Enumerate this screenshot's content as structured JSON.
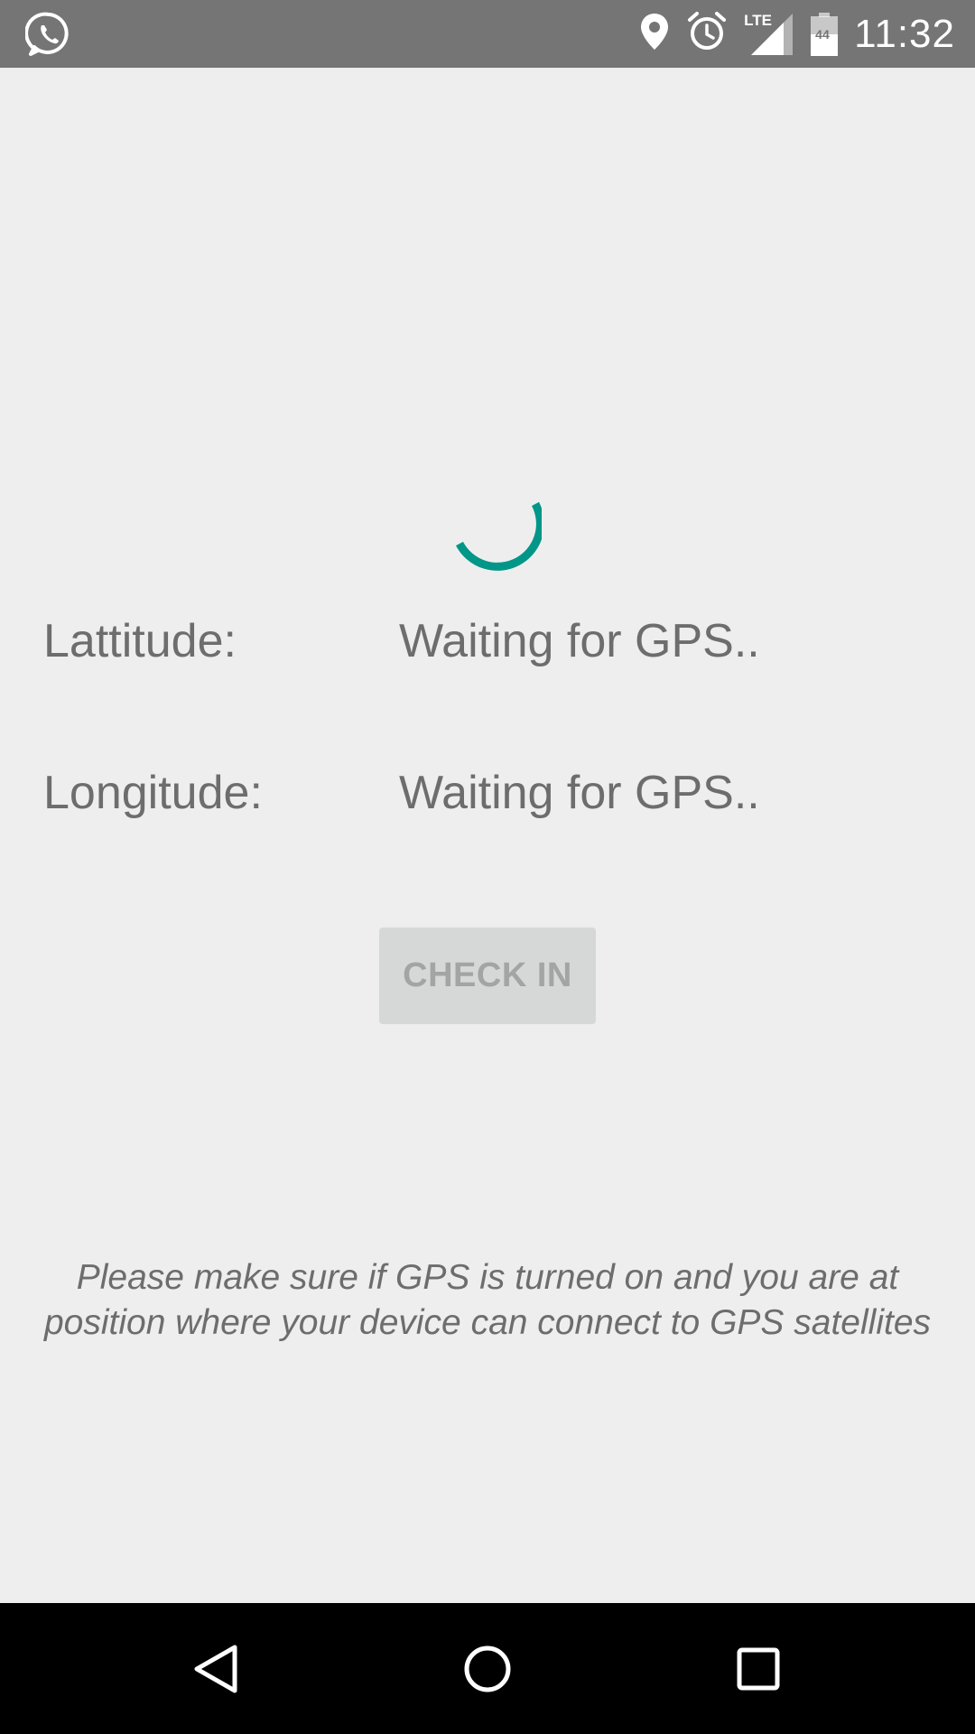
{
  "status_bar": {
    "time": "11:32",
    "network_label": "LTE",
    "battery_level": "44",
    "icons": [
      "whatsapp-icon",
      "location-pin-icon",
      "alarm-icon",
      "lte-signal-icon",
      "battery-icon"
    ]
  },
  "main": {
    "latitude_label": "Lattitude:",
    "latitude_value": "Waiting for GPS..",
    "longitude_label": "Longitude:",
    "longitude_value": "Waiting for GPS..",
    "checkin_label": "CHECK IN",
    "notice_line1": "Please make sure if GPS is turned on and you are at",
    "notice_line2": "position where your device can connect to GPS satellites"
  },
  "colors": {
    "status_bar": "#757575",
    "background": "#eeeeee",
    "spinner": "#009688",
    "text": "#6d6d6d",
    "button_disabled": "#d6d7d7",
    "nav_bar": "#000000"
  },
  "nav_bar": {
    "icons": [
      "back-icon",
      "home-icon",
      "recents-icon"
    ]
  }
}
